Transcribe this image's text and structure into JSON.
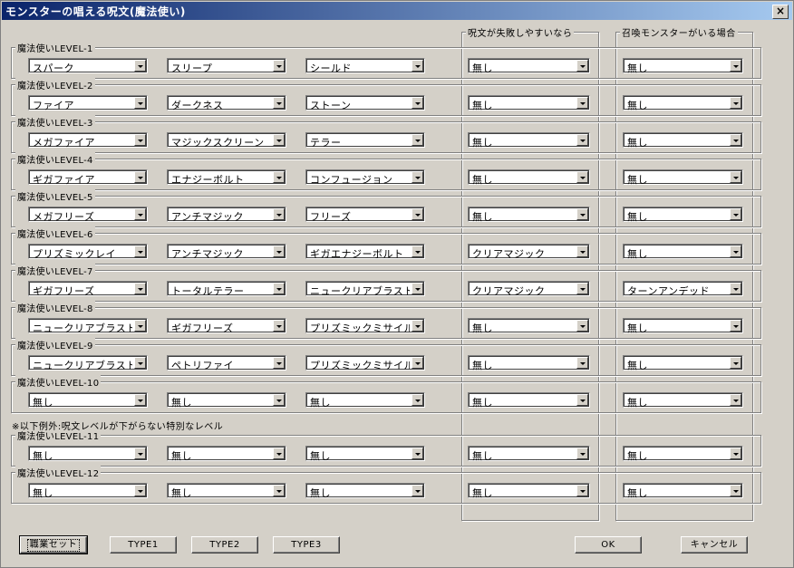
{
  "window": {
    "title": "モンスターの唱える呪文(魔法使い)",
    "close_label": "×"
  },
  "columns": {
    "fail_header": "呪文が失敗しやすいなら",
    "summon_header": "召喚モンスターがいる場合"
  },
  "note": "※以下例外:呪文レベルが下がらない特別なレベル",
  "levels": [
    {
      "label": "魔法使いLEVEL-1",
      "s1": "スパーク",
      "s2": "スリープ",
      "s3": "シールド",
      "fail": "無し",
      "summon": "無し"
    },
    {
      "label": "魔法使いLEVEL-2",
      "s1": "ファイア",
      "s2": "ダークネス",
      "s3": "ストーン",
      "fail": "無し",
      "summon": "無し"
    },
    {
      "label": "魔法使いLEVEL-3",
      "s1": "メガファイア",
      "s2": "マジックスクリーン",
      "s3": "テラー",
      "fail": "無し",
      "summon": "無し"
    },
    {
      "label": "魔法使いLEVEL-4",
      "s1": "ギガファイア",
      "s2": "エナジーボルト",
      "s3": "コンフュージョン",
      "fail": "無し",
      "summon": "無し"
    },
    {
      "label": "魔法使いLEVEL-5",
      "s1": "メガフリーズ",
      "s2": "アンチマジック",
      "s3": "フリーズ",
      "fail": "無し",
      "summon": "無し"
    },
    {
      "label": "魔法使いLEVEL-6",
      "s1": "プリズミックレイ",
      "s2": "アンチマジック",
      "s3": "ギガエナジーボルト",
      "fail": "クリアマジック",
      "summon": "無し"
    },
    {
      "label": "魔法使いLEVEL-7",
      "s1": "ギガフリーズ",
      "s2": "トータルテラー",
      "s3": "ニュークリアブラスト",
      "fail": "クリアマジック",
      "summon": "ターンアンデッド"
    },
    {
      "label": "魔法使いLEVEL-8",
      "s1": "ニュークリアブラスト",
      "s2": "ギガフリーズ",
      "s3": "プリズミックミサイル",
      "fail": "無し",
      "summon": "無し"
    },
    {
      "label": "魔法使いLEVEL-9",
      "s1": "ニュークリアブラスト",
      "s2": "ペトリファイ",
      "s3": "プリズミックミサイル",
      "fail": "無し",
      "summon": "無し"
    },
    {
      "label": "魔法使いLEVEL-10",
      "s1": "無し",
      "s2": "無し",
      "s3": "無し",
      "fail": "無し",
      "summon": "無し"
    },
    {
      "label": "魔法使いLEVEL-11",
      "s1": "無し",
      "s2": "無し",
      "s3": "無し",
      "fail": "無し",
      "summon": "無し"
    },
    {
      "label": "魔法使いLEVEL-12",
      "s1": "無し",
      "s2": "無し",
      "s3": "無し",
      "fail": "無し",
      "summon": "無し"
    }
  ],
  "buttons": {
    "preset": "職業セット",
    "type1": "TYPE1",
    "type2": "TYPE2",
    "type3": "TYPE3",
    "ok": "OK",
    "cancel": "キャンセル"
  }
}
